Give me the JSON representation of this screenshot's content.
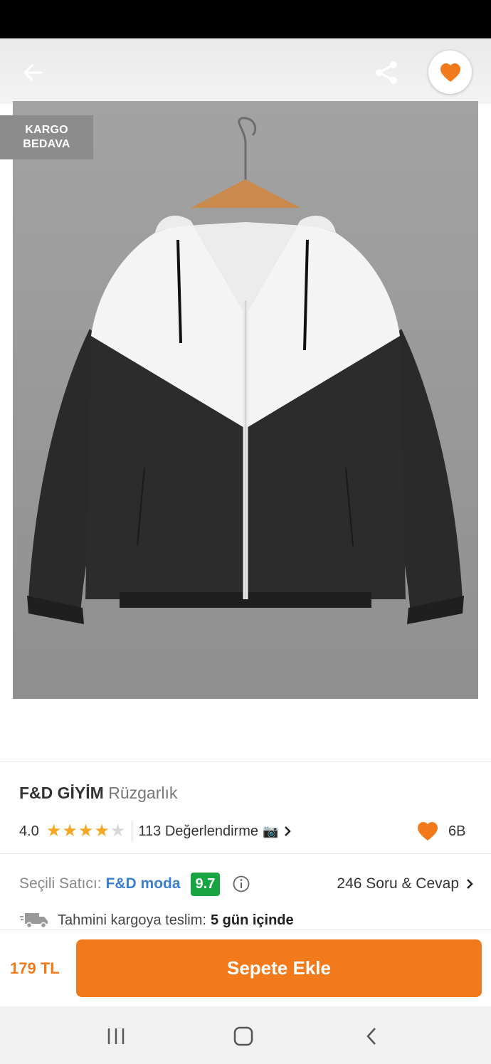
{
  "header": {
    "back_icon": "arrow-left-icon",
    "share_icon": "share-icon",
    "favorite_icon": "heart-icon"
  },
  "promo_badge": {
    "line1": "KARGO",
    "line2": "BEDAVA"
  },
  "product": {
    "brand": "F&D GİYİM",
    "name": "Rüzgarlık",
    "rating": "4.0",
    "stars_filled": 4,
    "stars_total": 5,
    "reviews_label": "113 Değerlendirme",
    "favorites": "6B"
  },
  "seller": {
    "label": "Seçili Satıcı:",
    "name": "F&D moda",
    "score": "9.7",
    "qa_label": "246 Soru & Cevap"
  },
  "shipping": {
    "label": "Tahmini kargoya teslim:",
    "value": "5 gün içinde"
  },
  "purchase": {
    "price": "179 TL",
    "add_to_cart": "Sepete Ekle"
  },
  "colors": {
    "accent": "#f27a1a",
    "score_green": "#19a442",
    "seller_blue": "#3b7fd3",
    "star": "#f5a623"
  }
}
